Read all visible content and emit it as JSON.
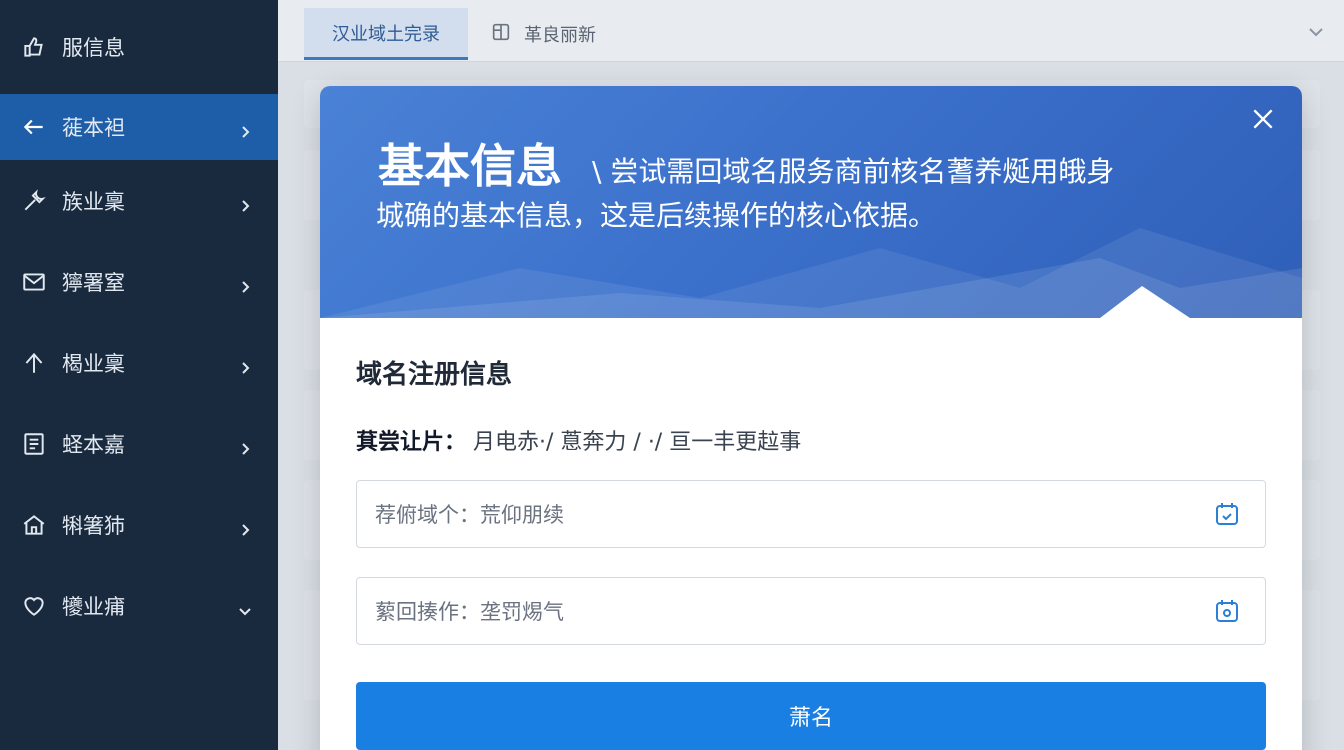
{
  "sidebar": {
    "items": [
      {
        "label": "服信息",
        "icon": "thumb-icon",
        "active": false,
        "chevron": "none"
      },
      {
        "label": "蓰本袒",
        "icon": "arrow-left-icon",
        "active": true,
        "chevron": "right"
      },
      {
        "label": "族业稟",
        "icon": "wrench-icon",
        "active": false,
        "chevron": "right"
      },
      {
        "label": "獰署窒",
        "icon": "mail-icon",
        "active": false,
        "chevron": "right"
      },
      {
        "label": "楬业稟",
        "icon": "arrow-up-icon",
        "active": false,
        "chevron": "right"
      },
      {
        "label": "蛏本嘉",
        "icon": "document-icon",
        "active": false,
        "chevron": "right"
      },
      {
        "label": "犐箸犻",
        "icon": "home-icon",
        "active": false,
        "chevron": "right"
      },
      {
        "label": "犪业痡",
        "icon": "heart-icon",
        "active": false,
        "chevron": "down"
      }
    ]
  },
  "tabs": {
    "active_label": "汉业域土完录",
    "second_label": "革良丽新",
    "second_icon": "tag-icon"
  },
  "modal": {
    "title": "基本信息",
    "desc_line1": "\\ 尝试需回域名服务商前核名蓍养烻用皒身",
    "desc_line2": "城确的基本信息，这是后续操作的核心依据。",
    "section_title": "域名注册信息",
    "hint_label": "萁尝让片：",
    "hint_text": "月电赤·/ 蒠奔力 / ·/ 亘一丰更趇事",
    "field1_value": "荐俯域个：荒仰朋续",
    "field2_value": "蕠回揍作：垄罚焬气",
    "field_icon": "calendar-icon",
    "submit_label": "萧名",
    "close_icon": "close-icon"
  },
  "colors": {
    "sidebar_bg": "#1a2a3e",
    "sidebar_active": "#1e5ea8",
    "modal_header": "#3a6fca",
    "primary": "#1a7fe3"
  }
}
